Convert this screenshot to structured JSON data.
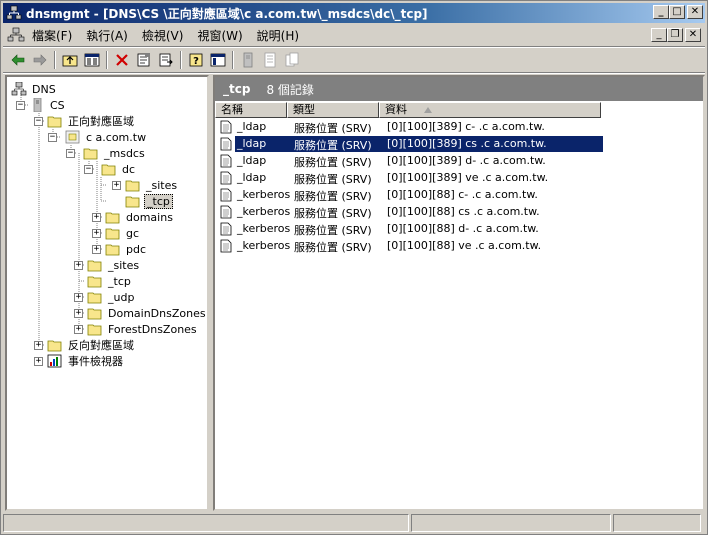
{
  "window": {
    "title": "dnsmgmt - [DNS\\CS     \\正向對應區域\\c          a.com.tw\\_msdcs\\dc\\_tcp]",
    "minimize": "_",
    "maximize": "□",
    "close": "✕"
  },
  "menu": {
    "items": [
      {
        "label": "檔案(F)"
      },
      {
        "label": "執行(A)"
      },
      {
        "label": "檢視(V)"
      },
      {
        "label": "視窗(W)"
      },
      {
        "label": "說明(H)"
      }
    ],
    "mdi_minimize": "_",
    "mdi_restore": "❐",
    "mdi_close": "✕"
  },
  "toolbar": {
    "icons": [
      "back-icon",
      "forward-icon",
      "up-folder-icon",
      "show-hide-tree-icon",
      "delete-icon",
      "properties-icon",
      "export-list-icon",
      "help-icon",
      "console-tree-icon",
      "server-icon",
      "record-icon",
      "copy-records-icon"
    ]
  },
  "tree": {
    "nodes": [
      {
        "label": "DNS"
      },
      {
        "label": "CS     "
      },
      {
        "label": "正向對應區域"
      },
      {
        "label": "c          a.com.tw"
      },
      {
        "label": "_msdcs"
      },
      {
        "label": "dc"
      },
      {
        "label": "_sites"
      },
      {
        "label": "_tcp"
      },
      {
        "label": "domains"
      },
      {
        "label": "gc"
      },
      {
        "label": "pdc"
      },
      {
        "label": "_sites"
      },
      {
        "label": "_tcp"
      },
      {
        "label": "_udp"
      },
      {
        "label": "DomainDnsZones"
      },
      {
        "label": "ForestDnsZones"
      },
      {
        "label": "反向對應區域"
      },
      {
        "label": "事件檢視器"
      }
    ]
  },
  "right": {
    "title": "_tcp",
    "count": "8 個記錄",
    "columns": [
      {
        "label": "名稱"
      },
      {
        "label": "類型"
      },
      {
        "label": "資料"
      }
    ],
    "rows": [
      {
        "name": "_ldap",
        "type": "服務位置 (SRV)",
        "data": "[0][100][389] c-        .c          a.com.tw."
      },
      {
        "name": "_ldap",
        "type": "服務位置 (SRV)",
        "data": "[0][100][389] cs     .c          a.com.tw."
      },
      {
        "name": "_ldap",
        "type": "服務位置 (SRV)",
        "data": "[0][100][389] d-        .c          a.com.tw."
      },
      {
        "name": "_ldap",
        "type": "服務位置 (SRV)",
        "data": "[0][100][389] ve          .c          a.com.tw."
      },
      {
        "name": "_kerberos",
        "type": "服務位置 (SRV)",
        "data": "[0][100][88] c-        .c          a.com.tw."
      },
      {
        "name": "_kerberos",
        "type": "服務位置 (SRV)",
        "data": "[0][100][88] cs     .c          a.com.tw."
      },
      {
        "name": "_kerberos",
        "type": "服務位置 (SRV)",
        "data": "[0][100][88] d-        .c          a.com.tw."
      },
      {
        "name": "_kerberos",
        "type": "服務位置 (SRV)",
        "data": "[0][100][88] ve          .c          a.com.tw."
      }
    ]
  },
  "colors": {
    "title_gradient_start": "#0a246a",
    "title_gradient_end": "#a6caf0",
    "selection": "#0a246a",
    "folder": "#f8e68c",
    "face": "#d4d0c8"
  }
}
